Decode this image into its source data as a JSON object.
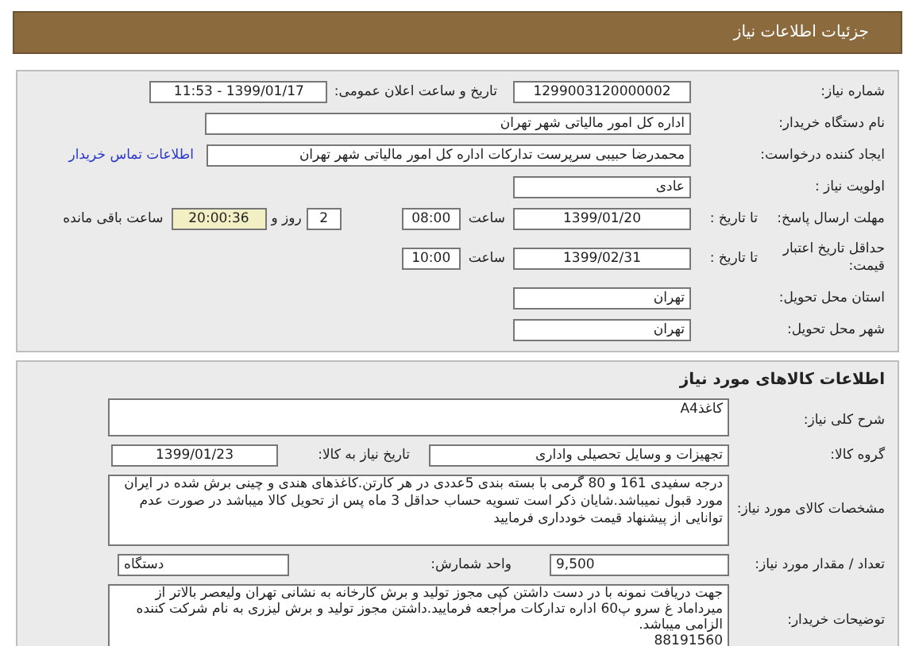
{
  "header": {
    "title": "جزئیات اطلاعات نیاز"
  },
  "need": {
    "need_number": {
      "label": "شماره نیاز:",
      "value": "1299003120000002"
    },
    "announce": {
      "label": "تاریخ و ساعت اعلان عمومی:",
      "value": "1399/01/17 - 11:53"
    },
    "buyer": {
      "label": "نام دستگاه خریدار:",
      "value": "اداره کل امور مالیاتی شهر تهران"
    },
    "creator": {
      "label": "ایجاد کننده درخواست:",
      "value": "محمدرضا حبیبی سرپرست تدارکات اداره کل امور مالیاتی شهر تهران",
      "link": "اطلاعات تماس خریدار"
    },
    "priority": {
      "label": "اولویت نیاز :",
      "value": "عادی"
    },
    "deadline": {
      "label": "مهلت ارسال پاسخ:",
      "to_label": "تا تاریخ :",
      "date": "1399/01/20",
      "time_label": "ساعت",
      "time": "08:00",
      "days": "2",
      "days_label": "روز و",
      "remaining": "20:00:36",
      "remaining_label": "ساعت باقی مانده"
    },
    "validity": {
      "label": "حداقل تاریخ اعتبار قیمت:",
      "to_label": "تا تاریخ :",
      "date": "1399/02/31",
      "time_label": "ساعت",
      "time": "10:00"
    },
    "province": {
      "label": "استان محل تحویل:",
      "value": "تهران"
    },
    "city": {
      "label": "شهر محل تحویل:",
      "value": "تهران"
    }
  },
  "goods": {
    "title": "اطلاعات کالاهای مورد نیاز",
    "summary": {
      "label": "شرح کلی نیاز:",
      "value": "کاغذA4"
    },
    "group": {
      "label": "گروه کالا:",
      "value": "تجهیزات و وسایل تحصیلی واداری",
      "date_label": "تاریخ نیاز به کالا:",
      "date": "1399/01/23"
    },
    "specs": {
      "label": "مشخصات کالای مورد نیاز:",
      "value": "درجه سفیدی 161 و 80 گرمی با بسته بندی 5عددی در هر کارتن.کاغذهای هندی و چینی برش شده در ایران مورد قبول نمیباشد.شایان ذکر است تسویه حساب حداقل 3 ماه پس از تحویل کالا میباشد در صورت عدم توانایی از پیشنهاد قیمت خودداری فرمایید"
    },
    "quantity": {
      "label": "تعداد / مقدار مورد نیاز:",
      "value": "9,500",
      "unit_label": "واحد شمارش:",
      "unit": "دستگاه"
    },
    "notes": {
      "label": "توضیحات خریدار:",
      "lines": [
        "جهت دریافت نمونه با در دست داشتن کپی مجوز تولید و برش کارخانه به نشانی تهران ولیعصر بالاتر از میرداماد غ سرو پ60 اداره تدارکات مراجعه فرمایید.داشتن مجوز تولید و برش لیزری به نام شرکت کننده الزامی میباشد.",
        "88191560"
      ]
    }
  }
}
